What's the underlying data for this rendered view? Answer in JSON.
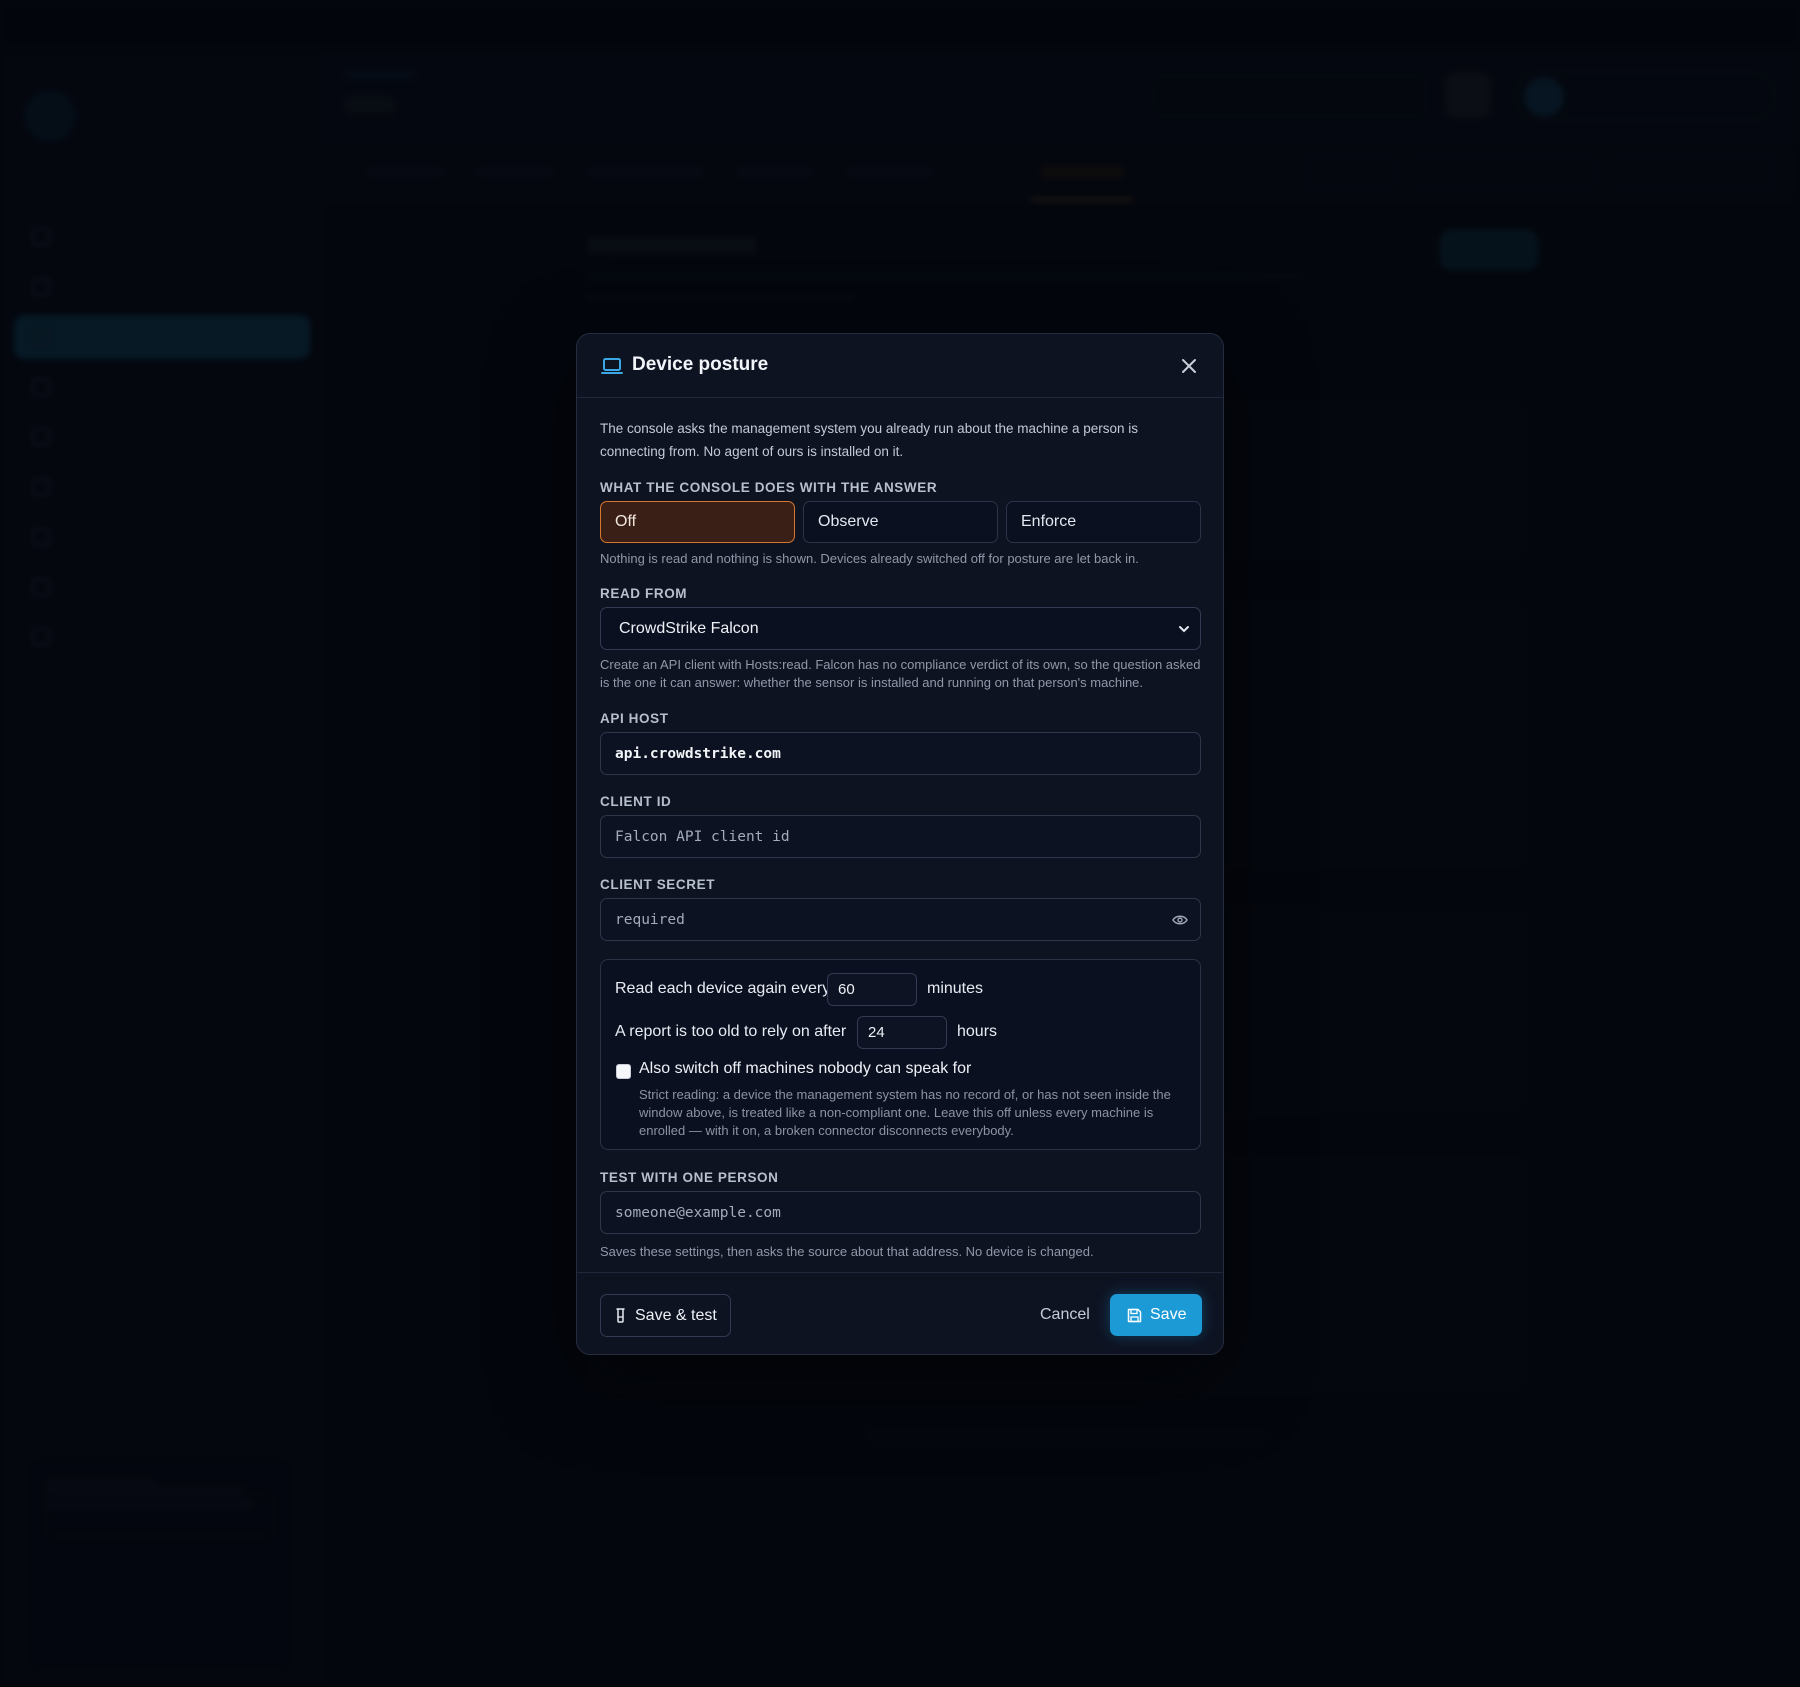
{
  "modal": {
    "title": "Device posture",
    "intro": "The console asks the management system you already run about the machine a person is connecting from. No agent of ours is installed on it.",
    "mode": {
      "label": "What the console does with the answer",
      "options": [
        "Off",
        "Observe",
        "Enforce"
      ],
      "selected": "Off",
      "hint": "Nothing is read and nothing is shown. Devices already switched off for posture are let back in."
    },
    "source": {
      "label": "Read from",
      "value": "CrowdStrike Falcon",
      "hint": "Create an API client with Hosts:read. Falcon has no compliance verdict of its own, so the question asked is the one it can answer: whether the sensor is installed and running on that person's machine."
    },
    "api_host": {
      "label": "API host",
      "value": "api.crowdstrike.com"
    },
    "client_id": {
      "label": "Client ID",
      "placeholder": "Falcon API client id"
    },
    "client_secret": {
      "label": "Client secret",
      "placeholder": "required"
    },
    "schedule": {
      "reread_prefix": "Read each device again every",
      "reread_value": "60",
      "reread_unit": "minutes",
      "stale_prefix": "A report is too old to rely on after",
      "stale_value": "24",
      "stale_unit": "hours",
      "strict_label": "Also switch off machines nobody can speak for",
      "strict_checked": false,
      "strict_hint": "Strict reading: a device the management system has no record of, or has not seen inside the window above, is treated like a non-compliant one. Leave this off unless every machine is enrolled — with it on, a broken connector disconnects everybody."
    },
    "test": {
      "label": "Test with one person",
      "placeholder": "someone@example.com",
      "hint": "Saves these settings, then asks the source about that address. No device is changed."
    },
    "footer": {
      "save_test": "Save & test",
      "cancel": "Cancel",
      "save": "Save"
    }
  },
  "colors": {
    "accent": "#1c9ad6",
    "selected_border": "#d6772e",
    "selected_bg": "#3a1f17"
  }
}
